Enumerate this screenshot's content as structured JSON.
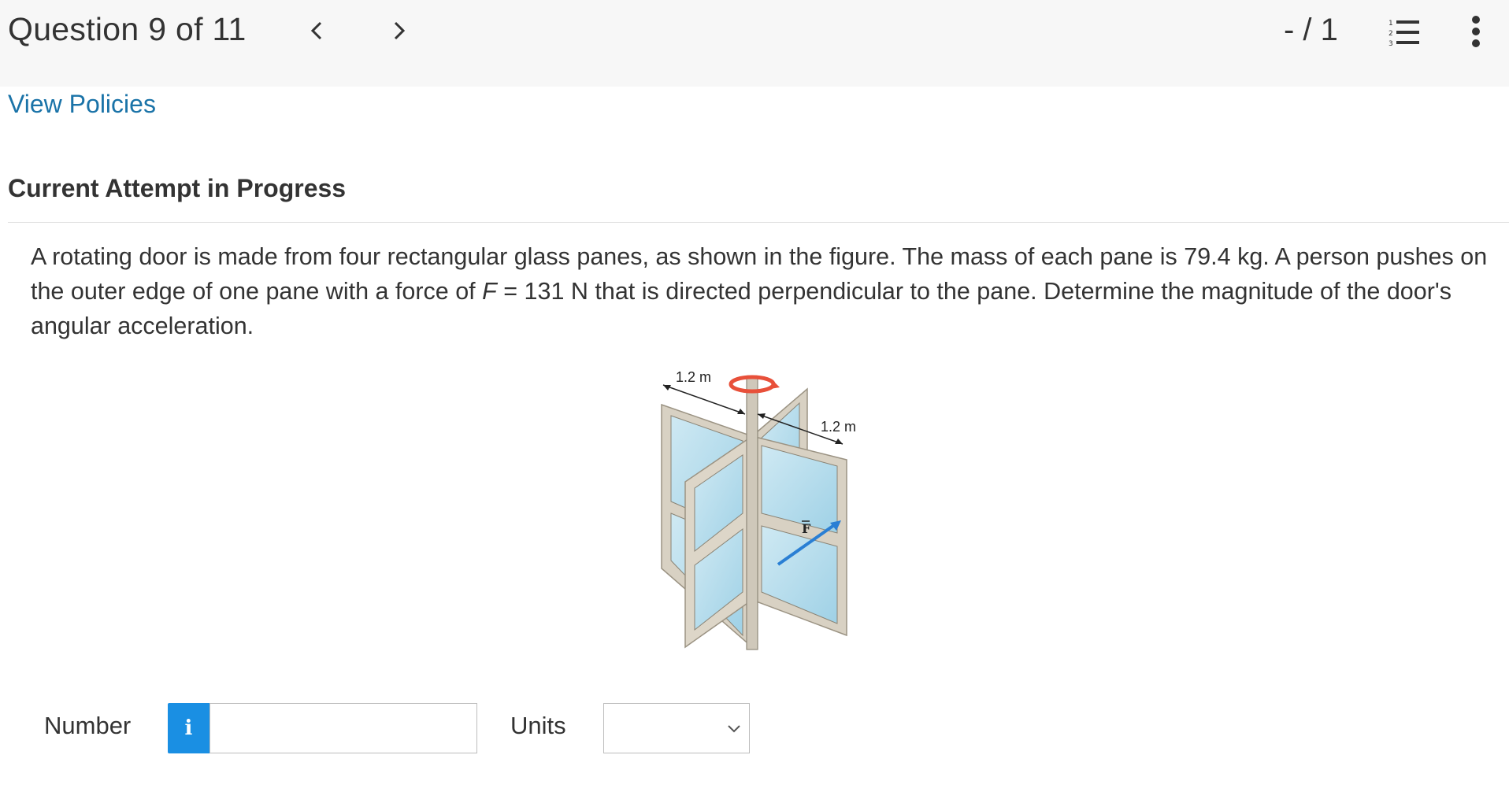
{
  "header": {
    "question_counter": "Question 9 of 11",
    "prev_symbol": "<",
    "next_symbol": ">",
    "score": "- / 1"
  },
  "links": {
    "view_policies": "View Policies"
  },
  "attempt": {
    "status": "Current Attempt in Progress"
  },
  "question": {
    "text_part1": "A rotating door is made from four rectangular glass panes, as shown in the figure. The mass of each pane is 79.4 kg. A person pushes on the outer edge of one pane with a force of ",
    "force_variable": "F",
    "text_part2": " = 131 N that is directed perpendicular to the pane. Determine the magnitude of the door's angular acceleration."
  },
  "figure": {
    "dimension_label_1": "1.2 m",
    "dimension_label_2": "1.2 m",
    "force_label": "F"
  },
  "answer": {
    "number_label": "Number",
    "info_symbol": "i",
    "number_value": "",
    "units_label": "Units",
    "units_selected": ""
  },
  "colors": {
    "link": "#1a73a8",
    "info_button": "#1a8fe3",
    "header_bg": "#f7f7f7"
  },
  "icons": [
    "chevron-left-icon",
    "chevron-right-icon",
    "numbered-list-icon",
    "more-vertical-icon",
    "info-icon",
    "chevron-down-icon"
  ]
}
